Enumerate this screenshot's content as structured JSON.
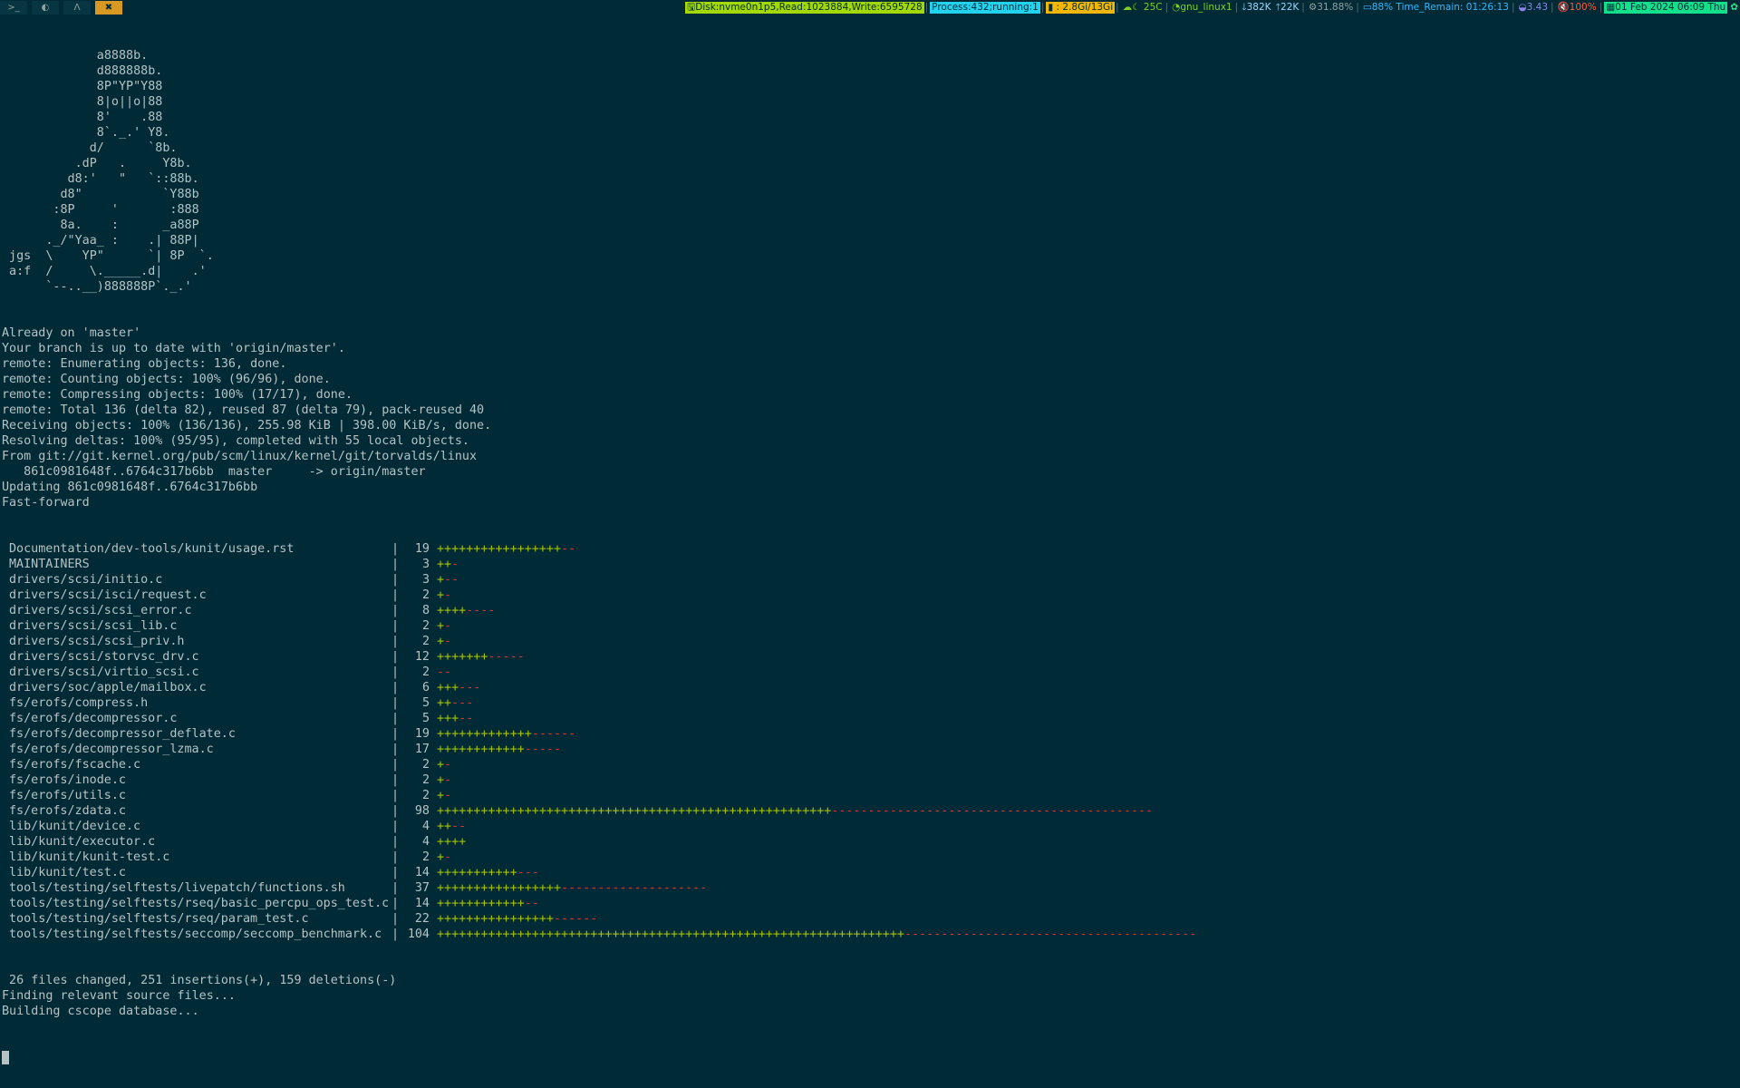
{
  "workspaces": [
    {
      "icon": "terminal-icon",
      "glyph": ">_",
      "active": false
    },
    {
      "icon": "browser-icon",
      "glyph": "◐",
      "active": false
    },
    {
      "icon": "linux-icon",
      "glyph": "Λ",
      "active": false
    },
    {
      "icon": "tools-icon",
      "glyph": "✖",
      "active": true
    }
  ],
  "status": {
    "disk": "Disk:nvme0n1p5,Read:1023884,Write:6595728",
    "process": "Process:432;running:1",
    "memory": " : 2.8Gi/13Gi",
    "weather": "☾ 25C",
    "wifi": "gnu_linux1",
    "download": "382K",
    "upload": "22K",
    "cpu": "31.88%",
    "battery": "88% Time_Remain: 01:26:13",
    "load": "3.43",
    "volume": "100%",
    "date": "01 Feb 2024 06:09 Thu"
  },
  "terminal": {
    "art": [
      "             a8888b.",
      "             d888888b.",
      "             8P\"YP\"Y88",
      "             8|o||o|88",
      "             8'    .88",
      "             8`._.' Y8.",
      "            d/      `8b.",
      "          .dP   .     Y8b.",
      "         d8:'   \"   `::88b.",
      "        d8\"           `Y88b",
      "       :8P     '       :888",
      "        8a.    :      _a88P",
      "      ._/\"Yaa_ :    .| 88P|",
      " jgs  \\    YP\"      `| 8P  `.",
      " a:f  /     \\._____.d|    .'",
      "      `--..__)888888P`._.'"
    ],
    "pre_lines": [
      "Already on 'master'",
      "Your branch is up to date with 'origin/master'.",
      "remote: Enumerating objects: 136, done.",
      "remote: Counting objects: 100% (96/96), done.",
      "remote: Compressing objects: 100% (17/17), done.",
      "remote: Total 136 (delta 82), reused 87 (delta 79), pack-reused 40",
      "Receiving objects: 100% (136/136), 255.98 KiB | 398.00 KiB/s, done.",
      "Resolving deltas: 100% (95/95), completed with 55 local objects.",
      "From git://git.kernel.org/pub/scm/linux/kernel/git/torvalds/linux",
      "   861c0981648f..6764c317b6bb  master     -> origin/master",
      "Updating 861c0981648f..6764c317b6bb",
      "Fast-forward"
    ],
    "diffstat": [
      {
        "path": "Documentation/dev-tools/kunit/usage.rst",
        "count": "19",
        "plus": 17,
        "minus": 2
      },
      {
        "path": "MAINTAINERS",
        "count": "3",
        "plus": 2,
        "minus": 1
      },
      {
        "path": "drivers/scsi/initio.c",
        "count": "3",
        "plus": 1,
        "minus": 2
      },
      {
        "path": "drivers/scsi/isci/request.c",
        "count": "2",
        "plus": 1,
        "minus": 1
      },
      {
        "path": "drivers/scsi/scsi_error.c",
        "count": "8",
        "plus": 4,
        "minus": 4
      },
      {
        "path": "drivers/scsi/scsi_lib.c",
        "count": "2",
        "plus": 1,
        "minus": 1
      },
      {
        "path": "drivers/scsi/scsi_priv.h",
        "count": "2",
        "plus": 1,
        "minus": 1
      },
      {
        "path": "drivers/scsi/storvsc_drv.c",
        "count": "12",
        "plus": 7,
        "minus": 5
      },
      {
        "path": "drivers/scsi/virtio_scsi.c",
        "count": "2",
        "plus": 0,
        "minus": 2
      },
      {
        "path": "drivers/soc/apple/mailbox.c",
        "count": "6",
        "plus": 3,
        "minus": 3
      },
      {
        "path": "fs/erofs/compress.h",
        "count": "5",
        "plus": 2,
        "minus": 3
      },
      {
        "path": "fs/erofs/decompressor.c",
        "count": "5",
        "plus": 3,
        "minus": 2
      },
      {
        "path": "fs/erofs/decompressor_deflate.c",
        "count": "19",
        "plus": 13,
        "minus": 6
      },
      {
        "path": "fs/erofs/decompressor_lzma.c",
        "count": "17",
        "plus": 12,
        "minus": 5
      },
      {
        "path": "fs/erofs/fscache.c",
        "count": "2",
        "plus": 1,
        "minus": 1
      },
      {
        "path": "fs/erofs/inode.c",
        "count": "2",
        "plus": 1,
        "minus": 1
      },
      {
        "path": "fs/erofs/utils.c",
        "count": "2",
        "plus": 1,
        "minus": 1
      },
      {
        "path": "fs/erofs/zdata.c",
        "count": "98",
        "plus": 54,
        "minus": 44
      },
      {
        "path": "lib/kunit/device.c",
        "count": "4",
        "plus": 2,
        "minus": 2
      },
      {
        "path": "lib/kunit/executor.c",
        "count": "4",
        "plus": 4,
        "minus": 0
      },
      {
        "path": "lib/kunit/kunit-test.c",
        "count": "2",
        "plus": 1,
        "minus": 1
      },
      {
        "path": "lib/kunit/test.c",
        "count": "14",
        "plus": 11,
        "minus": 3
      },
      {
        "path": "tools/testing/selftests/livepatch/functions.sh",
        "count": "37",
        "plus": 17,
        "minus": 20
      },
      {
        "path": "tools/testing/selftests/rseq/basic_percpu_ops_test.c",
        "count": "14",
        "plus": 12,
        "minus": 2
      },
      {
        "path": "tools/testing/selftests/rseq/param_test.c",
        "count": "22",
        "plus": 16,
        "minus": 6
      },
      {
        "path": "tools/testing/selftests/seccomp/seccomp_benchmark.c",
        "count": "104",
        "plus": 64,
        "minus": 40
      }
    ],
    "post_lines": [
      " 26 files changed, 251 insertions(+), 159 deletions(-)",
      "Finding relevant source files...",
      "Building cscope database..."
    ]
  }
}
